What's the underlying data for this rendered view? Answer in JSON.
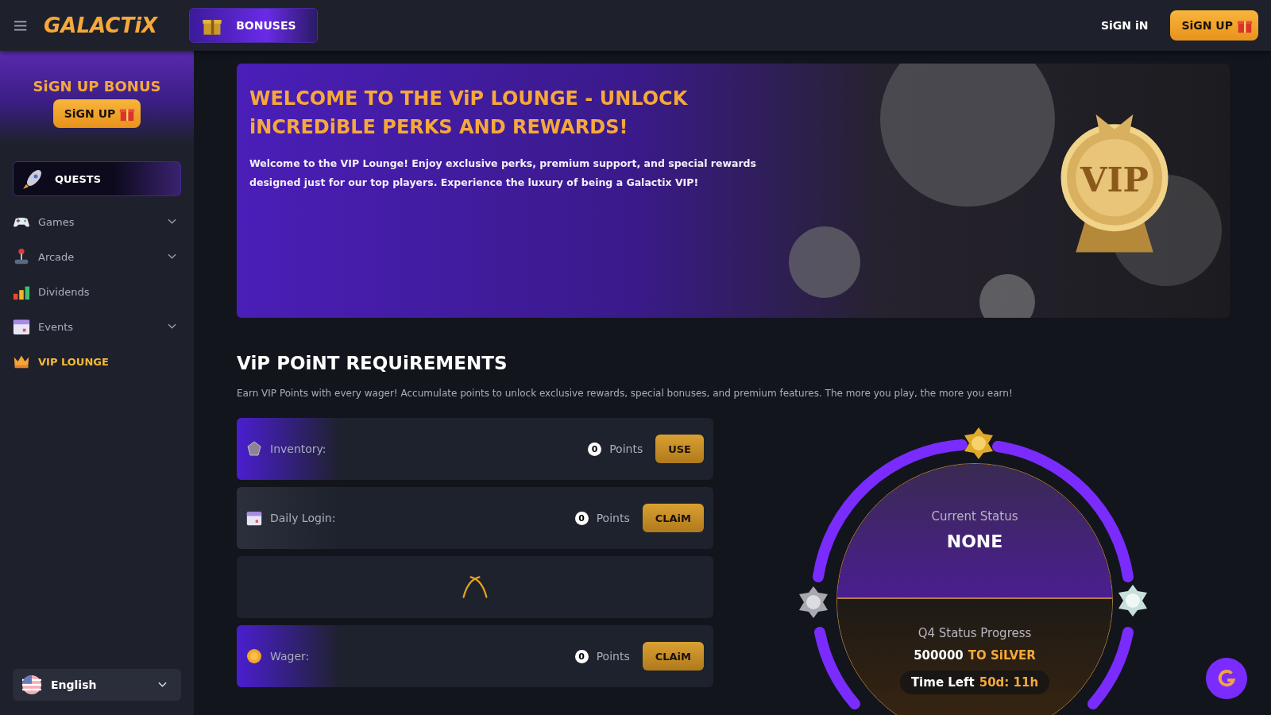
{
  "header": {
    "logo": "GALACTiX",
    "bonuses_button": "BONUSES",
    "sign_in": "SiGN iN",
    "sign_up": "SiGN UP"
  },
  "sidebar": {
    "promo_title": "SiGN UP BONUS",
    "promo_button": "SiGN UP",
    "quests": "QUESTS",
    "items": [
      {
        "label": "Games",
        "kind": "group",
        "selected": false
      },
      {
        "label": "Arcade",
        "kind": "group",
        "selected": false
      },
      {
        "label": "Dividends",
        "kind": "link",
        "selected": false
      },
      {
        "label": "Events",
        "kind": "group",
        "selected": false
      },
      {
        "label": "VIP LOUNGE",
        "kind": "link",
        "selected": true
      }
    ],
    "language": "English"
  },
  "banner": {
    "title": "WELCOME TO THE ViP LOUNGE - UNLOCK iNCREDiBLE PERKS AND REWARDS!",
    "text": "Welcome to the VIP Lounge! Enjoy exclusive perks, premium support, and special rewards designed just for our top players. Experience the luxury of being a Galactix VIP!",
    "badge": "VIP"
  },
  "requirements": {
    "title": "ViP POiNT REQUiREMENTS",
    "description": "Earn VIP Points with every wager! Accumulate points to unlock exclusive rewards, special bonuses, and premium features. The more you play, the more you earn!",
    "rows": [
      {
        "kind": "points",
        "label": "Inventory:",
        "points": "0",
        "unit": "Points",
        "button": "USE",
        "highlighted": true
      },
      {
        "kind": "points",
        "label": "Daily Login:",
        "points": "0",
        "unit": "Points",
        "button": "CLAiM",
        "highlighted": false
      },
      {
        "kind": "loading"
      },
      {
        "kind": "points",
        "label": "Wager:",
        "points": "0",
        "unit": "Points",
        "button": "CLAiM",
        "highlighted": true
      }
    ]
  },
  "status": {
    "label": "Current Status",
    "value": "NONE",
    "progress_label": "Q4 Status Progress",
    "progress_amount": "500000",
    "progress_target": "TO SiLVER",
    "time_label": "Time Left",
    "time_value": "50d: 11h"
  }
}
